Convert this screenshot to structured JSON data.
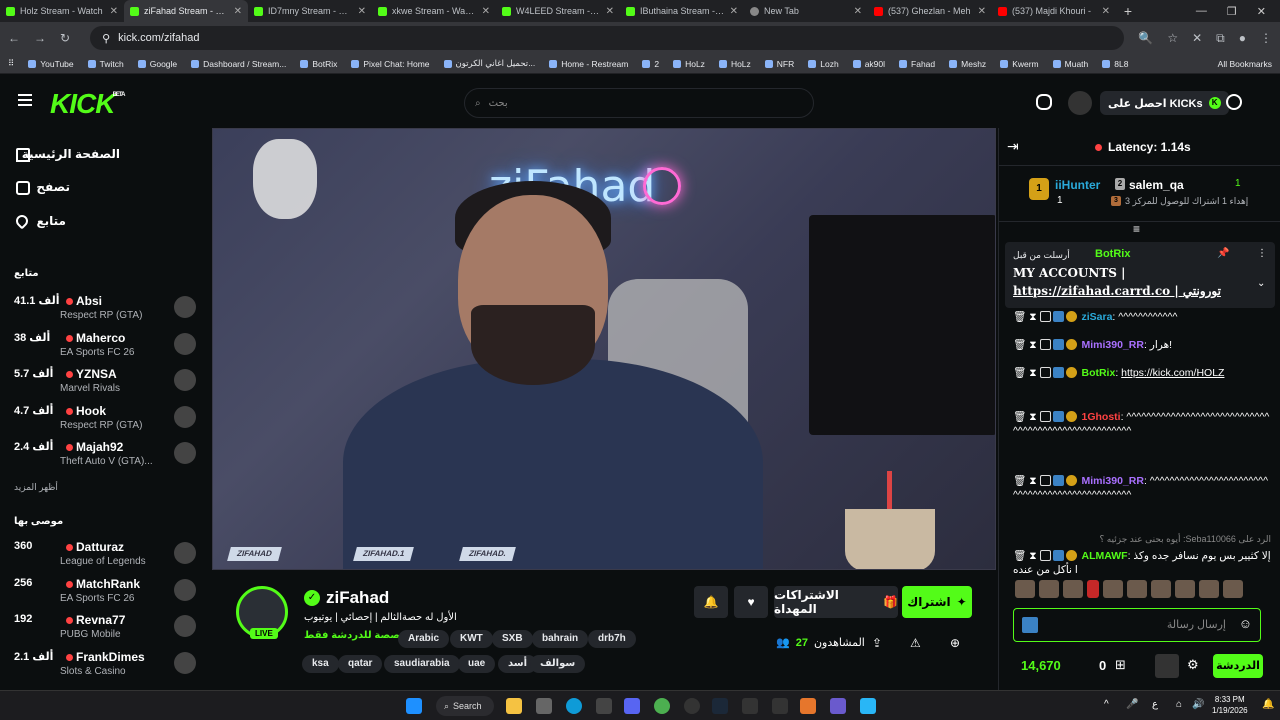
{
  "browser": {
    "tabs": [
      {
        "title": "Holz Stream - Watch",
        "active": false,
        "icon": "kick"
      },
      {
        "title": "ziFahad Stream - Wat",
        "active": true,
        "icon": "kick"
      },
      {
        "title": "ID7mny Stream - Wat",
        "active": false,
        "icon": "kick"
      },
      {
        "title": "xkwe Stream - Watch",
        "active": false,
        "icon": "kick"
      },
      {
        "title": "W4LEED Stream - Wa",
        "active": false,
        "icon": "kick"
      },
      {
        "title": "IButhaina Stream - W",
        "active": false,
        "icon": "kick"
      },
      {
        "title": "New Tab",
        "active": false,
        "icon": "chrome"
      },
      {
        "title": "(537) Ghezlan - Meh",
        "active": false,
        "icon": "youtube"
      },
      {
        "title": "(537) Majdi Khouri -",
        "active": false,
        "icon": "youtube"
      }
    ],
    "new_tab_label": "+",
    "url": "kick.com/zifahad",
    "bookmarks": [
      "YouTube",
      "Twitch",
      "Google",
      "Dashboard / Stream...",
      "BotRix",
      "Pixel Chat: Home",
      "تحميل اغاني الكرتون...",
      "Home - Restream",
      "2",
      "HoLz",
      "HoLz",
      "NFR",
      "Lozh",
      "ak90l",
      "Fahad",
      "Meshz",
      "Kwerm",
      "Muath",
      "8L8"
    ],
    "all_bookmarks": "All Bookmarks"
  },
  "header": {
    "logo": "KICK",
    "logo_badge": "BETA",
    "search_placeholder": "بحث",
    "get_kicks": "احصل على KICKs"
  },
  "sidebar": {
    "nav": [
      {
        "label": "الصفحة الرئيسية",
        "icon": "home-icon"
      },
      {
        "label": "تصفح",
        "icon": "browse-icon"
      },
      {
        "label": "متابع",
        "icon": "heart-icon"
      }
    ],
    "following_title": "متابع",
    "following": [
      {
        "count": "41.1 ألف",
        "name": "Absi",
        "game": "Respect RP (GTA)"
      },
      {
        "count": "38 ألف",
        "name": "Maherco",
        "game": "EA Sports FC 26"
      },
      {
        "count": "5.7 ألف",
        "name": "YZNSA",
        "game": "Marvel Rivals"
      },
      {
        "count": "4.7 ألف",
        "name": "Hook",
        "game": "Respect RP (GTA)"
      },
      {
        "count": "2.4 ألف",
        "name": "Majah92",
        "game": "Theft Auto V (GTA)..."
      }
    ],
    "show_more": "أظهر المزيد",
    "recommended_title": "موصى بها",
    "recommended": [
      {
        "count": "360",
        "name": "Datturaz",
        "game": "League of Legends"
      },
      {
        "count": "256",
        "name": "MatchRank",
        "game": "EA Sports FC 26"
      },
      {
        "count": "192",
        "name": "Revna77",
        "game": "PUBG Mobile"
      },
      {
        "count": "2.1 ألف",
        "name": "FrankDimes",
        "game": "Slots & Casino"
      }
    ]
  },
  "video": {
    "neon_text": "ziFahad",
    "watermarks": [
      "ZIFAHAD",
      "ZIFAHAD.1",
      "ZIFAHAD."
    ]
  },
  "channel": {
    "name": "ziFahad",
    "live": "LIVE",
    "title": "الأول له حصةالثالم | إحصائي | يوتيوب",
    "category": "مخصصة للدردشة فقط",
    "tags": [
      "Arabic",
      "KWT",
      "SXB",
      "bahrain",
      "drb7h",
      "ksa",
      "qatar",
      "saudiarabia",
      "uae",
      "أسد",
      "سوالف"
    ],
    "subscribe": "اشتراك",
    "gift_subs": "الاشتراكات المهداة",
    "viewers_label": "المشاهدون",
    "viewers": "27"
  },
  "chat": {
    "latency": "Latency: 1.14s",
    "gifters": [
      {
        "name": "iiHunter",
        "count": "1",
        "rank": "1"
      },
      {
        "name": "salem_qa",
        "count": "1",
        "rank": "2"
      }
    ],
    "gift_hint": "إهداء 1 اشتراك للوصول للمركز 3",
    "gift_hint_rank": "3",
    "pinned": {
      "sent_by": "أرسلت من قبل",
      "user": "BotRix",
      "line1": "MY ACCOUNTS |",
      "line2": "https://zifahad.carrd.co | تورونتي"
    },
    "messages": [
      {
        "user": "ziSara",
        "text": "^^^^^^^^^^^^",
        "color": "#2aa9d9"
      },
      {
        "user": "Mimi390_RR",
        "text": "هرار!",
        "color": "#a970ff"
      },
      {
        "user": "BotRix",
        "text": "https://kick.com/HOLZ",
        "color": "#53fc18"
      },
      {
        "user": "1Ghosti",
        "text": "^^^^^^^^^^^^^^^^^^^^^^^^^^^^^^^^^^^^^^^^^^^^^^^^^^^^^",
        "color": "#ff4242"
      },
      {
        "user": "Mimi390_RR",
        "text": "^^^^^^^^^^^^^^^^^^^^^^^^^^^^^^^^^^^^^^^^^^^^^^^^",
        "color": "#a970ff"
      },
      {
        "user": "ALMAWF",
        "text": "إلا كثيير بس يوم نسافر جده وكذا نأكل من عنده",
        "color": "#53fc18",
        "reply": "الرد على Seba110066: أيوه بحنى عند جزئيه ؟"
      }
    ],
    "input_placeholder": "إرسال رسالة",
    "points": "14,670",
    "gift_count": "0",
    "send": "الدردشة"
  },
  "taskbar": {
    "search": "Search",
    "time": "8:33 PM",
    "date": "1/19/2026",
    "lang": "ع"
  }
}
